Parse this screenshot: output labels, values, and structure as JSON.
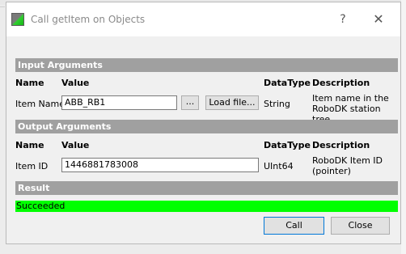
{
  "window": {
    "title": "Call getItem on Objects",
    "help_glyph": "?",
    "close_glyph": "✕"
  },
  "input_args": {
    "section_title": "Input Arguments",
    "headers": {
      "name": "Name",
      "value": "Value",
      "datatype": "DataType",
      "description": "Description"
    },
    "row": {
      "name": "Item Name",
      "value": "ABB_RB1",
      "browse_label": "...",
      "load_label": "Load file...",
      "datatype": "String",
      "description_line1": "Item name in the",
      "description_line2": "RoboDK station tree"
    }
  },
  "output_args": {
    "section_title": "Output Arguments",
    "headers": {
      "name": "Name",
      "value": "Value",
      "datatype": "DataType",
      "description": "Description"
    },
    "row": {
      "name": "Item ID",
      "value": "1446881783008",
      "datatype": "UInt64",
      "description_line1": "RoboDK Item ID",
      "description_line2": "(pointer)"
    }
  },
  "result": {
    "section_title": "Result",
    "status": "Succeeded",
    "status_color": "#00ff00"
  },
  "buttons": {
    "call": "Call",
    "close": "Close"
  }
}
